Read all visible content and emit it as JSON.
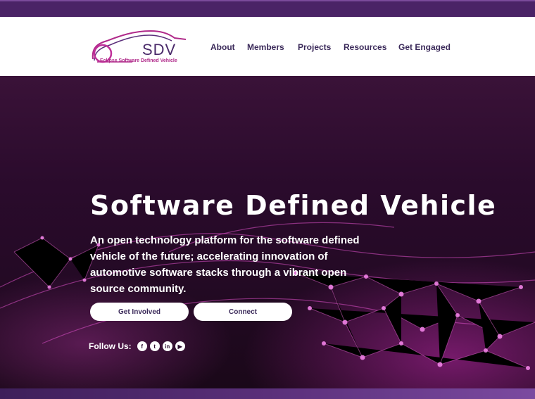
{
  "header": {
    "logo_text": "SDV",
    "logo_sub": "Eclipse Software Defined Vehicle",
    "nav": [
      {
        "label": "About"
      },
      {
        "label": "Members"
      },
      {
        "label": "Projects"
      },
      {
        "label": "Resources"
      },
      {
        "label": "Get Engaged"
      }
    ]
  },
  "hero": {
    "title": "Software Defined Vehicle",
    "description": "An open technology platform for the software defined vehicle of the future; accelerating innovation of automotive software stacks through a vibrant open source community.",
    "buttons": {
      "get_involved": "Get Involved",
      "connect": "Connect"
    },
    "follow_label": "Follow Us:",
    "social": [
      {
        "icon": "facebook-icon",
        "glyph": "f"
      },
      {
        "icon": "twitter-icon",
        "glyph": "t"
      },
      {
        "icon": "linkedin-icon",
        "glyph": "in"
      },
      {
        "icon": "youtube-icon",
        "glyph": "▶"
      }
    ]
  },
  "colors": {
    "brand_purple": "#4a2366",
    "nav_text": "#3b2a5a",
    "accent_magenta": "#c0309a"
  }
}
